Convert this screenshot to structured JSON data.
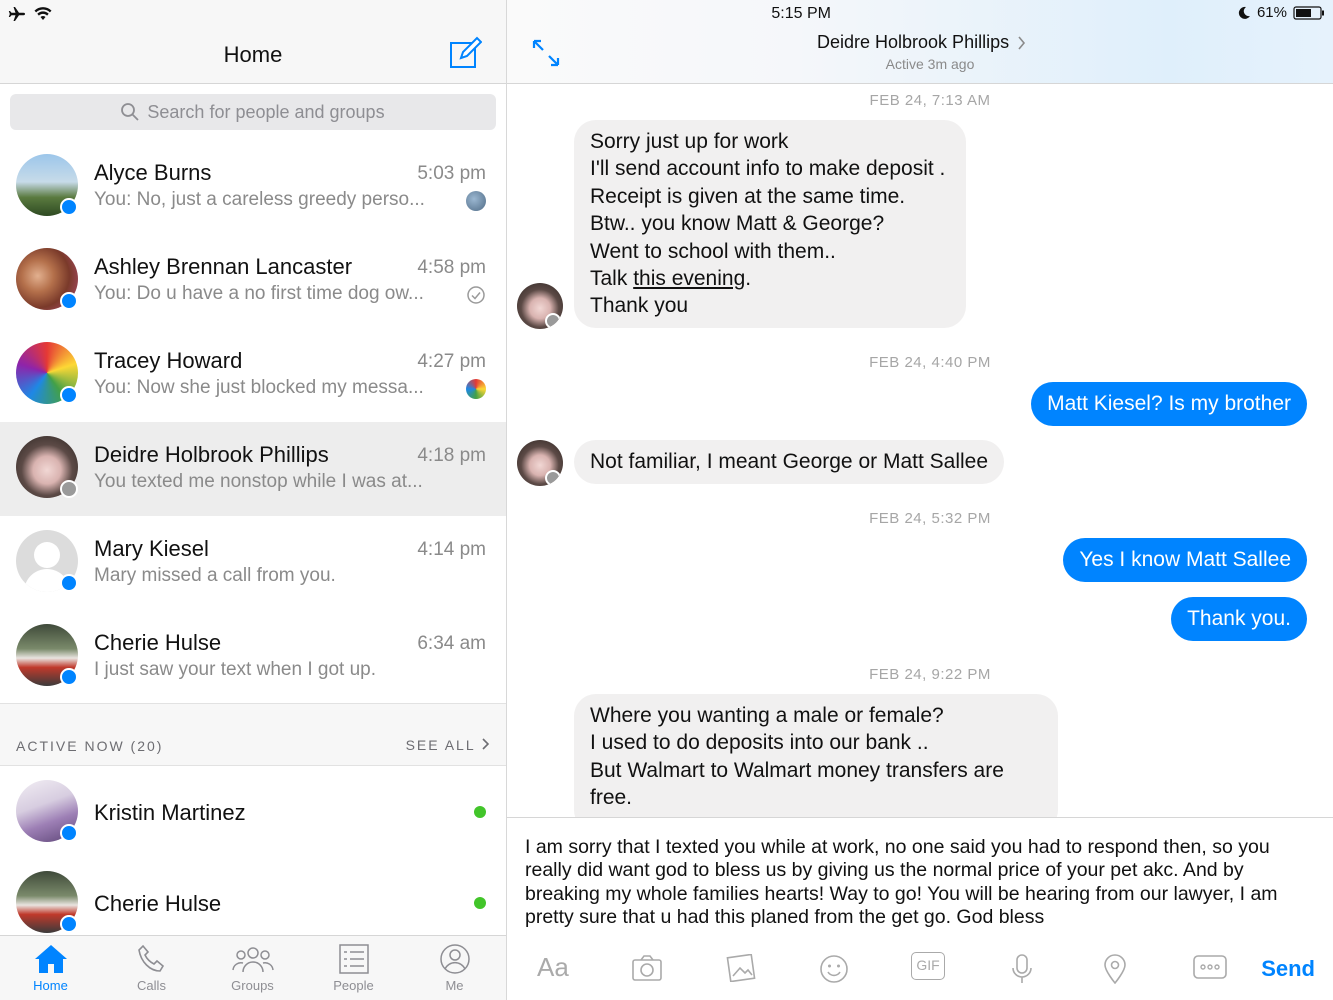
{
  "status_bar": {
    "time": "5:15 PM",
    "battery": "61%"
  },
  "left": {
    "title": "Home",
    "search_placeholder": "Search for people and groups",
    "conversations": [
      {
        "name": "Alyce Burns",
        "time": "5:03 pm",
        "preview": "You: No, just a careless greedy perso..."
      },
      {
        "name": "Ashley Brennan Lancaster",
        "time": "4:58 pm",
        "preview": "You: Do u have a no first time dog ow..."
      },
      {
        "name": "Tracey Howard",
        "time": "4:27 pm",
        "preview": "You: Now she just blocked my messa..."
      },
      {
        "name": "Deidre Holbrook Phillips",
        "time": "4:18 pm",
        "preview": "You texted me nonstop while I was at..."
      },
      {
        "name": "Mary Kiesel",
        "time": "4:14 pm",
        "preview": "Mary missed a call from you."
      },
      {
        "name": "Cherie Hulse",
        "time": "6:34 am",
        "preview": "I just saw your text when I got up."
      }
    ],
    "active_now_label": "ACTIVE NOW (20)",
    "see_all_label": "SEE ALL",
    "active_people": [
      {
        "name": "Kristin Martinez"
      },
      {
        "name": "Cherie Hulse"
      }
    ],
    "tabs": [
      {
        "label": "Home",
        "icon": "home-icon"
      },
      {
        "label": "Calls",
        "icon": "phone-icon"
      },
      {
        "label": "Groups",
        "icon": "groups-icon"
      },
      {
        "label": "People",
        "icon": "people-list-icon"
      },
      {
        "label": "Me",
        "icon": "profile-icon"
      }
    ]
  },
  "chat": {
    "name": "Deidre Holbrook Phillips",
    "subtitle": "Active 3m ago",
    "stamps": [
      "FEB 24, 7:13 AM",
      "FEB 24, 4:40 PM",
      "FEB 24, 5:32 PM",
      "FEB 24, 9:22 PM"
    ],
    "msg1_lines": [
      "Sorry just up for work",
      "I'll send account info to make deposit .",
      "Receipt is given at the same time.",
      "Btw.. you know Matt & George?",
      "Went to school with them..",
      "Talk ",
      "this evening",
      ".",
      "Thank you"
    ],
    "msg2": "Matt Kiesel? Is my brother",
    "msg3": "Not familiar, I meant George or Matt Sallee",
    "msg4": "Yes I know Matt Sallee",
    "msg5": "Thank you.",
    "msg6_lines": [
      "Where you wanting a male or female?",
      "I used to do deposits into our bank ..",
      "But Walmart to Walmart money transfers are",
      "free."
    ],
    "composer_text": "I am sorry that I texted you while at work, no one said you had to respond then, so you really did want god to bless us by giving us the normal price of your pet akc. And by breaking my whole families hearts! Way to go! You will be hearing from our lawyer, I am pretty sure that u had this planed from the get go. God bless",
    "aa_label": "Aa",
    "gif_label": "GIF",
    "send_label": "Send"
  },
  "colors": {
    "accent": "#0084ff",
    "online": "#42c52a",
    "bubble_in": "#f1f0f0"
  }
}
